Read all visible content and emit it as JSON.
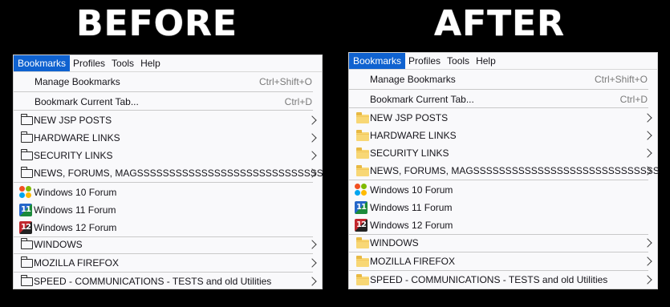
{
  "headings": {
    "before": "BEFORE",
    "after": "AFTER"
  },
  "menubar": [
    "Bookmarks",
    "Profiles",
    "Tools",
    "Help"
  ],
  "menu": {
    "manage": {
      "label": "Manage Bookmarks",
      "shortcut": "Ctrl+Shift+O"
    },
    "bookmark_tab": {
      "label": "Bookmark Current Tab...",
      "shortcut": "Ctrl+D"
    },
    "items": [
      "NEW JSP POSTS",
      "HARDWARE LINKS",
      "SECURITY LINKS",
      "NEWS, FORUMS, MAGSSSSSSSSSSSSSSSSSSSSSSSSSSSSS",
      "Windows 10 Forum",
      "Windows 11 Forum",
      "Windows 12 Forum",
      "WINDOWS",
      "MOZILLA FIREFOX",
      "SPEED - COMMUNICATIONS - TESTS and old Utilities"
    ],
    "icon_badges": {
      "win11": "11",
      "win12": "12"
    }
  },
  "colors": {
    "active_menu": "#0f62d0",
    "folder_yellow": "#f8d775"
  }
}
